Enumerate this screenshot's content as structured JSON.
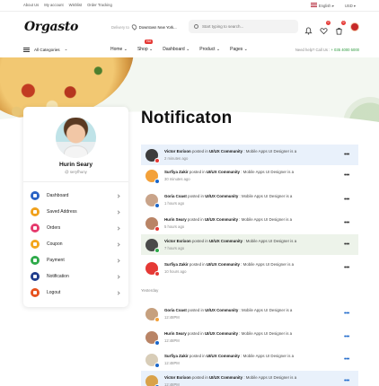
{
  "topbar": {
    "links": [
      "About Us",
      "My account",
      "Wishlist",
      "Order Tracking"
    ],
    "language": "English",
    "currency": "USD"
  },
  "header": {
    "logo": "Orgasto",
    "deliver_label": "Delivery to",
    "deliver_location": "Downtown New York...",
    "search_placeholder": "Start typing to search...",
    "cart_count": "0",
    "wishlist_count": "0"
  },
  "nav": {
    "categories": "All Categories",
    "items": [
      "Home",
      "Shop",
      "Dashboard",
      "Product",
      "Pages"
    ],
    "hot_badge": "Hot",
    "help_label": "Need help? Call Us :",
    "help_phone": "+ 035 4000 5000"
  },
  "page": {
    "title": "Notificaton"
  },
  "profile": {
    "name": "Hurin Seary",
    "handle": "@ seryfhuny",
    "menu": [
      {
        "label": "Dashboard",
        "icon": "dashboard-icon",
        "color": "#2962c4"
      },
      {
        "label": "Saved Address",
        "icon": "location-icon",
        "color": "#f0a11c"
      },
      {
        "label": "Orders",
        "icon": "orders-icon",
        "color": "#e53a6d"
      },
      {
        "label": "Coupon",
        "icon": "coupon-icon",
        "color": "#f3a61c"
      },
      {
        "label": "Payment",
        "icon": "payment-icon",
        "color": "#2eaa4a"
      },
      {
        "label": "Notification",
        "icon": "notification-icon",
        "color": "#1f3c8c"
      },
      {
        "label": "Logout",
        "icon": "logout-icon",
        "color": "#e6521f"
      }
    ]
  },
  "notifications": {
    "section_label": "Yesterday",
    "items": [
      {
        "name": "Victor Exrixon",
        "text": "posted in",
        "group": "UI/UX Community",
        "suffix": ": Mobile Apps UI Designer is a",
        "time": "2 minutes ago",
        "avatar": "#3c3c3c",
        "mini": "#e53935"
      },
      {
        "name": "Surfiya Zakir",
        "text": "posted in",
        "group": "UI/UX Community",
        "suffix": ": Mobile Apps UI Designer is a",
        "time": "30 minutes ago",
        "avatar": "#f3a13a",
        "mini": "#1a66c9"
      },
      {
        "name": "Goria Coast",
        "text": "posted in",
        "group": "UI/UX Community",
        "suffix": ": Mobile Apps UI Designer is a",
        "time": "1 hours ago",
        "avatar": "#c9a48a",
        "mini": "#1a66c9"
      },
      {
        "name": "Hurin Seary",
        "text": "posted in",
        "group": "UI/UX Community",
        "suffix": ": Mobile Apps UI Designer is a",
        "time": "5 hours ago",
        "avatar": "#b98466",
        "mini": "#e53935"
      },
      {
        "name": "Victor Exrixon",
        "text": "posted in",
        "group": "UI/UX Community",
        "suffix": ": Mobile Apps UI Designer is a",
        "time": "7 hours ago",
        "avatar": "#4a4a4a",
        "mini": "#2eaa4a"
      },
      {
        "name": "Surfiya Zakir",
        "text": "posted in",
        "group": "UI/UX Community",
        "suffix": ": Mobile Apps UI Designer is a",
        "time": "10 hours ago",
        "avatar": "#e53935",
        "mini": "#e53935"
      },
      {
        "name": "Goria Coast",
        "text": "posted in",
        "group": "UI/UX Community",
        "suffix": ": Mobile Apps UI Designer is a",
        "time": "12:48PM",
        "avatar": "#c6a07e",
        "mini": "#f3a13a"
      },
      {
        "name": "Hurin Seary",
        "text": "posted in",
        "group": "UI/UX Community",
        "suffix": ": Mobile Apps UI Designer is a",
        "time": "12:48PM",
        "avatar": "#b98466",
        "mini": "#1a66c9"
      },
      {
        "name": "Surfiya Zakir",
        "text": "posted in",
        "group": "UI/UX Community",
        "suffix": ": Mobile Apps UI Designer is a",
        "time": "12:48PM",
        "avatar": "#d8cdb8",
        "mini": "#1a66c9"
      },
      {
        "name": "Victor Exrixon",
        "text": "posted in",
        "group": "UI/UX Community",
        "suffix": ": Mobile Apps UI Designer is a",
        "time": "12:48PM",
        "avatar": "#d9a24a",
        "mini": "#1a66c9"
      }
    ]
  }
}
